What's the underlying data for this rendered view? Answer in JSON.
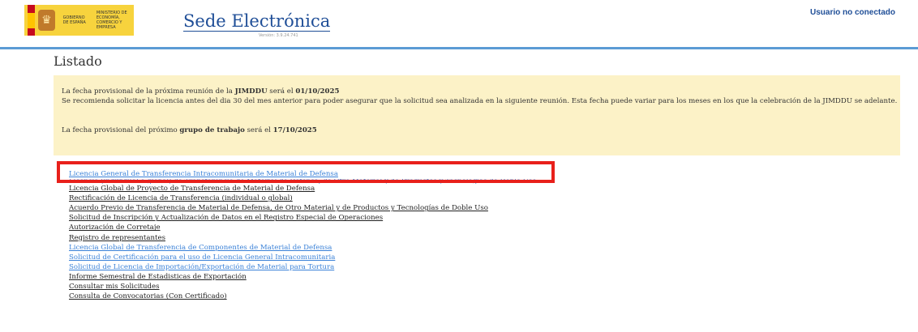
{
  "header": {
    "logo_left_text": "GOBIERNO DE ESPAÑA",
    "logo_right_text": "MINISTERIO DE ECONOMÍA, COMERCIO Y EMPRESA",
    "site_title": "Sede Electrónica",
    "version": "Versión: 3.9.24.741",
    "user_status": "Usuario no conectado"
  },
  "page": {
    "title": "Listado"
  },
  "notice": {
    "line1_pre": "La fecha provisional de la próxima reunión de la ",
    "line1_bold": "JIMDDU",
    "line1_mid": " será el ",
    "line1_date": "01/10/2025",
    "line2": "Se recomienda solicitar la licencia antes del dia 30 del mes anterior para poder asegurar que la solicitud sea analizada en la siguiente reunión. Esta fecha puede variar para los meses en los que la celebración de la JIMDDU se adelante.",
    "line3_pre": "La fecha provisional del próximo ",
    "line3_bold": "grupo de trabajo",
    "line3_mid": " será el ",
    "line3_date": "17/10/2025"
  },
  "links": [
    {
      "label": "Licencia General de Transferencia Intracomunitaria de Material de Defensa",
      "style": "blue"
    },
    {
      "label": "Licencia (individual o global) de Transferencia de Material de Defensa, de Otro Material y de Productos y Tecnologías de Doble Uso",
      "style": "strike"
    },
    {
      "label": "Licencia Global de Proyecto de Transferencia de Material de Defensa",
      "style": "dark"
    },
    {
      "label": "Rectificación de Licencia de Transferencia (individual o global)",
      "style": "dark"
    },
    {
      "label": "Acuerdo Previo de Transferencia de Material de Defensa, de Otro Material y de Productos y Tecnologías de Doble Uso",
      "style": "dark"
    },
    {
      "label": "Solicitud de Inscripción y Actualización de Datos en el Registro Especial de Operaciones",
      "style": "dark"
    },
    {
      "label": "Autorización de Corretaje",
      "style": "dark"
    },
    {
      "label": "Registro de representantes",
      "style": "dark"
    },
    {
      "label": "Licencia Global de Transferencia de Componentes de Material de Defensa",
      "style": "blue"
    },
    {
      "label": "Solicitud de Certificación para el uso de Licencia General Intracomunitaria",
      "style": "blue"
    },
    {
      "label": "Solicitud de Licencia de Importación/Exportación de Material para Tortura",
      "style": "blue"
    },
    {
      "label": "Informe Semestral de Estadisticas de Exportación",
      "style": "dark"
    },
    {
      "label": "Consultar mis Solicitudes",
      "style": "dark"
    },
    {
      "label": "Consulta de Convocatorias (Con Certificado)",
      "style": "dark"
    }
  ],
  "colors": {
    "accent_rule": "#5b9bd5",
    "notice_bg": "#fcf2c7",
    "highlight": "#e8201b"
  }
}
